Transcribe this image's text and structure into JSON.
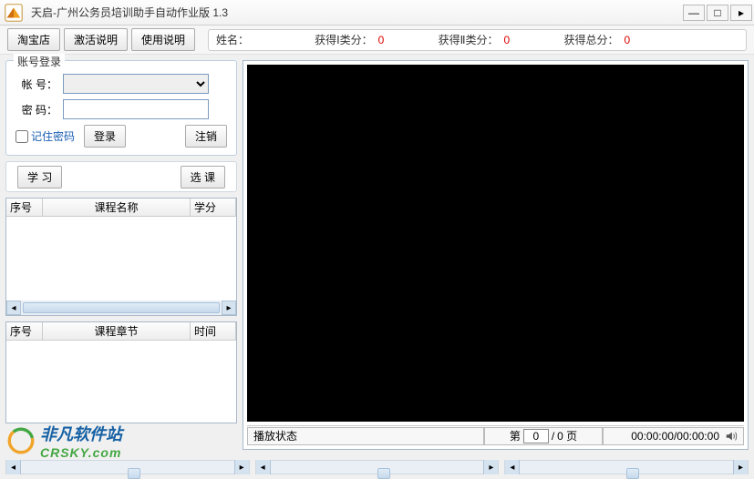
{
  "title": "天启-广州公务员培训助手自动作业版 1.3",
  "toolbar": {
    "taobao": "淘宝店",
    "activate": "激活说明",
    "usage": "使用说明"
  },
  "score": {
    "name_label": "姓名：",
    "cat1_label": "获得Ⅰ类分：",
    "cat1_value": "0",
    "cat2_label": "获得Ⅱ类分：",
    "cat2_value": "0",
    "total_label": "获得总分：",
    "total_value": "0"
  },
  "login": {
    "legend": "账号登录",
    "account_label": "帐  号：",
    "password_label": "密  码：",
    "remember": "记住密码",
    "login_btn": "登录",
    "logout_btn": "注销"
  },
  "actions": {
    "study": "学 习",
    "select_course": "选 课"
  },
  "grid1": {
    "col_no": "序号",
    "col_name": "课程名称",
    "col_credit": "学分"
  },
  "grid2": {
    "col_no": "序号",
    "col_chapter": "课程章节",
    "col_time": "时间"
  },
  "video": {
    "overlay": ""
  },
  "status": {
    "play_state": "播放状态",
    "page_prefix": "第",
    "page_current": "0",
    "page_sep": "/",
    "page_total": "0 页",
    "time": "00:00:00/00:00:00"
  },
  "watermark": {
    "line1": "非凡软件站",
    "line2": "CRSKY.com"
  }
}
